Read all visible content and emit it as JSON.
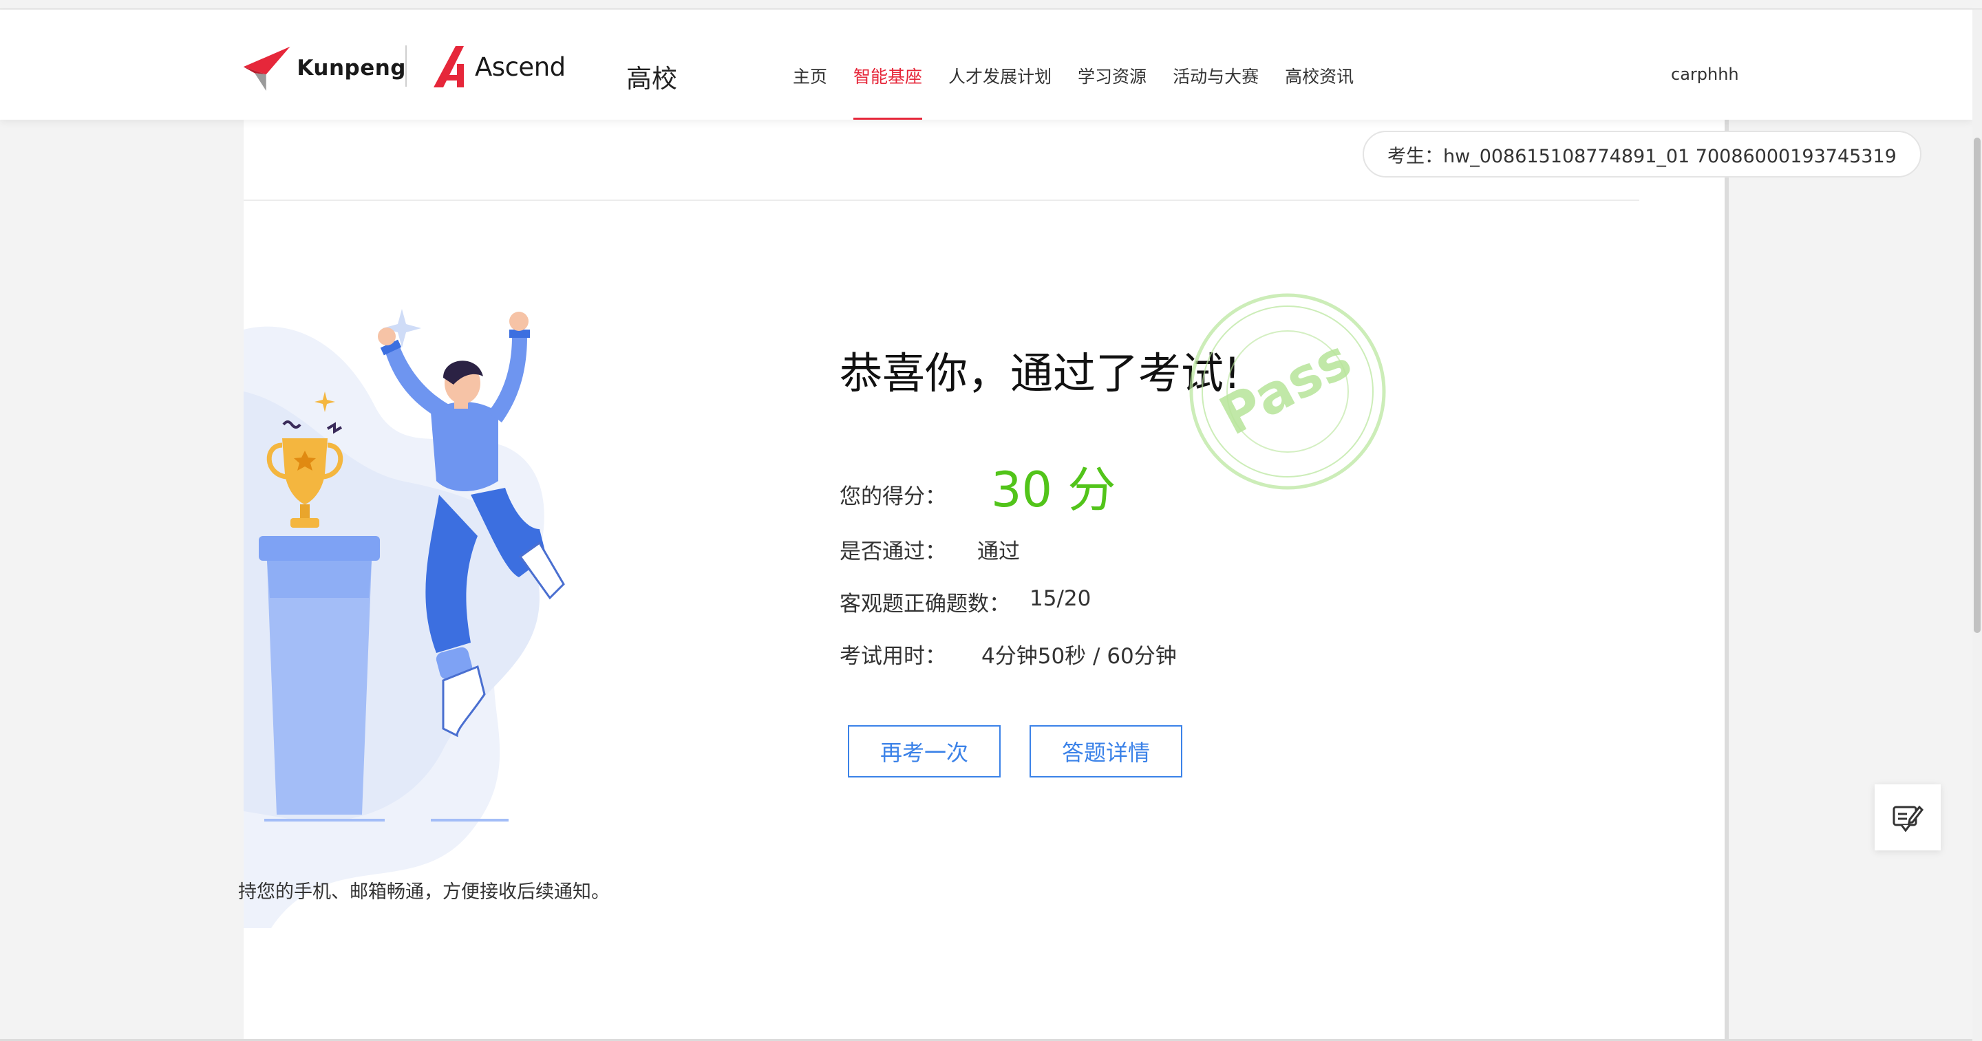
{
  "header": {
    "kunpeng_label": "Kunpeng",
    "ascend_label": "Ascend",
    "portal_label": "高校",
    "nav": [
      {
        "label": "主页",
        "active": false
      },
      {
        "label": "智能基座",
        "active": true
      },
      {
        "label": "人才发展计划",
        "active": false
      },
      {
        "label": "学习资源",
        "active": false
      },
      {
        "label": "活动与大赛",
        "active": false
      },
      {
        "label": "高校资讯",
        "active": false
      }
    ],
    "username": "carphhh"
  },
  "exam": {
    "candidate": "考生：hw_008615108774891_01 70086000193745319",
    "congrats": "恭喜你，通过了考试!",
    "stamp_text": "Pass",
    "score_label": "您的得分：",
    "score_value": "30 分",
    "pass_label": "是否通过：",
    "pass_value": "通过",
    "objective_label": "客观题正确题数：",
    "objective_value": "15/20",
    "time_label": "考试用时：",
    "time_value": "4分钟50秒 / 60分钟",
    "retake_button": "再考一次",
    "details_button": "答题详情",
    "notice": "持您的手机、邮箱畅通，方便接收后续通知。"
  },
  "colors": {
    "accent_red": "#e6273a",
    "score_green": "#52c41a",
    "button_blue": "#3b82e8",
    "stamp_green": "#b7e59a"
  },
  "icons": {
    "float_button": "edit-note-icon",
    "kunpeng_logo": "kunpeng-logo-icon",
    "ascend_logo": "ascend-logo-icon"
  }
}
